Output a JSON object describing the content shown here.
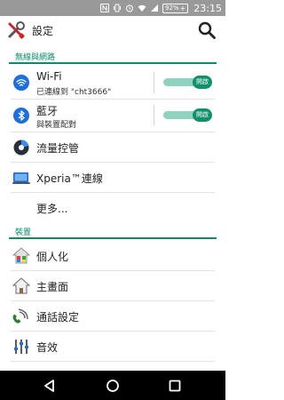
{
  "status_bar": {
    "battery_percent": "92%",
    "battery_plus": "+",
    "time": "23:15",
    "icons": [
      "nfc-icon",
      "vibrate-icon",
      "alarm-icon",
      "wifi-icon",
      "signal-icon",
      "battery-icon"
    ]
  },
  "app_bar": {
    "title": "設定",
    "icon": "settings-tools-icon",
    "search_icon": "search-icon"
  },
  "sections": {
    "network": {
      "header": "無線與網路"
    },
    "device": {
      "header": "裝置"
    }
  },
  "items": {
    "wifi": {
      "title": "Wi-Fi",
      "subtitle": "已連線到 \"cht3666\"",
      "toggle": "開啟",
      "enabled": true,
      "icon": "wifi-icon"
    },
    "bluetooth": {
      "title": "藍牙",
      "subtitle": "與裝置配對",
      "toggle": "開啟",
      "enabled": true,
      "icon": "bluetooth-icon"
    },
    "data_usage": {
      "title": "流量控管",
      "icon": "data-usage-icon"
    },
    "xperia": {
      "title": "Xperia™連線",
      "icon": "xperia-connectivity-icon"
    },
    "more": {
      "title": "更多..."
    },
    "personalization": {
      "title": "個人化",
      "icon": "personalization-icon"
    },
    "home_screen": {
      "title": "主畫面",
      "icon": "home-icon"
    },
    "call_settings": {
      "title": "通話設定",
      "icon": "phone-icon"
    },
    "sound": {
      "title": "音效",
      "icon": "equalizer-icon"
    }
  },
  "nav_bar": {
    "icons": [
      "back-icon",
      "home-icon",
      "recents-icon"
    ]
  },
  "colors": {
    "accent": "#0d8c6b",
    "toggle_track": "#8fd2bd",
    "toggle_knob": "#12906c",
    "status_bar": "#999999",
    "nav_bar": "#000000"
  }
}
